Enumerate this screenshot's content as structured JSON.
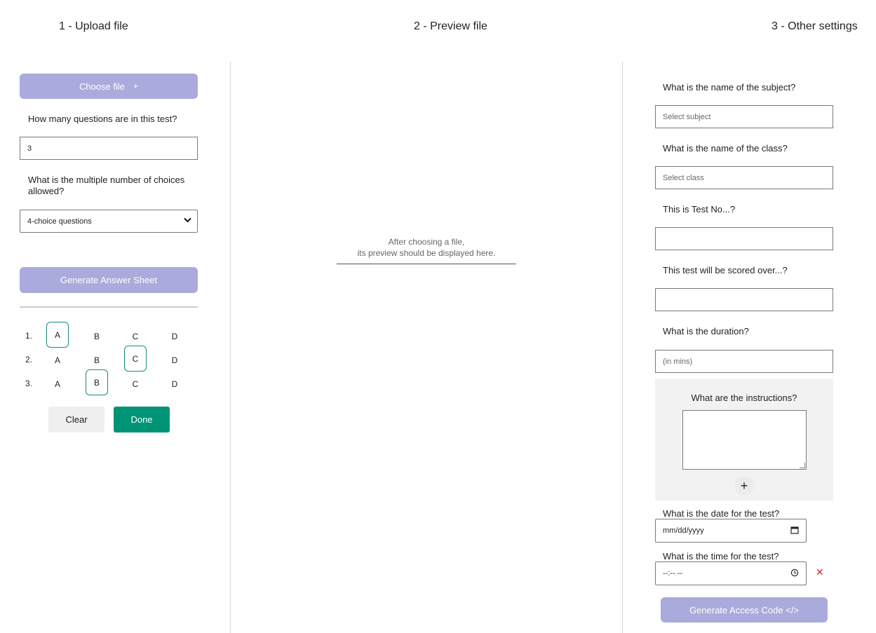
{
  "steps": {
    "step1": "1 - Upload file",
    "step2": "2 - Preview file",
    "step3": "3 - Other settings"
  },
  "upload": {
    "choose_label": "Choose file",
    "choose_icon": "+",
    "question_count_label": "How many questions are in this test?",
    "question_count_value": "3",
    "choices_label": "What is the multiple number of choices allowed?",
    "choices_selected": "4-choice questions",
    "generate_label": "Generate Answer Sheet"
  },
  "answer_sheet": {
    "questions": [
      {
        "num": "1.",
        "options": [
          "A",
          "B",
          "C",
          "D"
        ],
        "selected": "A"
      },
      {
        "num": "2.",
        "options": [
          "A",
          "B",
          "C",
          "D"
        ],
        "selected": "C"
      },
      {
        "num": "3.",
        "options": [
          "A",
          "B",
          "C",
          "D"
        ],
        "selected": "B"
      }
    ],
    "clear_label": "Clear",
    "done_label": "Done"
  },
  "preview": {
    "hint_line1": "After choosing a file,",
    "hint_line2": "its preview should be displayed here."
  },
  "settings": {
    "subject_label": "What is the name of the subject?",
    "subject_placeholder": "Select subject",
    "class_label": "What is the name of the class?",
    "class_placeholder": "Select class",
    "test_no_label": "This is Test No...?",
    "score_label": "This test will be scored over...?",
    "duration_label": "What is the duration?",
    "duration_placeholder": "(in mins)",
    "instructions_label": "What are the instructions?",
    "instructions_add": "+",
    "date_label": "What is the date for the test?",
    "date_placeholder": "mm/dd/yyyy",
    "time_label": "What is the time for the test?",
    "time_placeholder": "--:-- --",
    "time_clear": "✕",
    "access_code_label": "Generate Access Code </>"
  },
  "colors": {
    "accent_lavender": "#aaaadd",
    "done_green": "#009476",
    "selected_border": "#1a8a7e",
    "delete_red": "#e02020"
  }
}
